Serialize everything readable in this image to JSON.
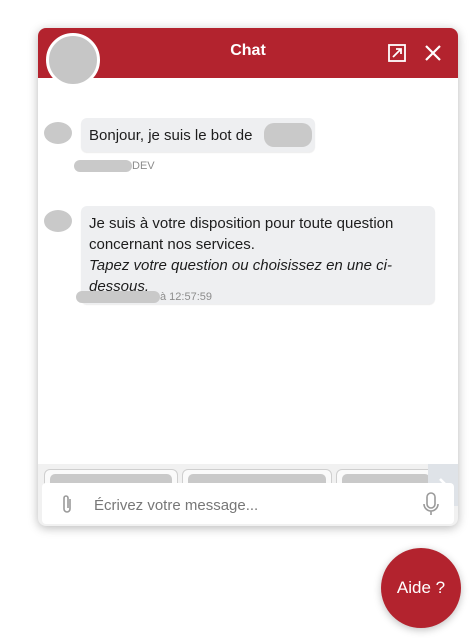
{
  "header": {
    "title": "Chat",
    "expand_icon": "expand-icon",
    "close_icon": "close-icon"
  },
  "messages": [
    {
      "text": "Bonjour, je suis le bot de",
      "meta_suffix": "DEV"
    },
    {
      "line1": "Je suis à votre disposition pour toute question",
      "line2": "concernant nos services.",
      "italic1": "Tapez votre question ou choisissez en une ci-",
      "italic2": "dessous.",
      "meta_suffix": "à 12:57:59"
    }
  ],
  "suggestions": {
    "next_icon": "chevron-right-icon"
  },
  "composer": {
    "placeholder": "Écrivez votre message...",
    "attach_icon": "paperclip-icon",
    "mic_icon": "microphone-icon"
  },
  "help_button": {
    "label": "Aide ?"
  },
  "colors": {
    "brand": "#b3232e",
    "bubble": "#eeeff1",
    "panel": "#f1f1f1"
  }
}
